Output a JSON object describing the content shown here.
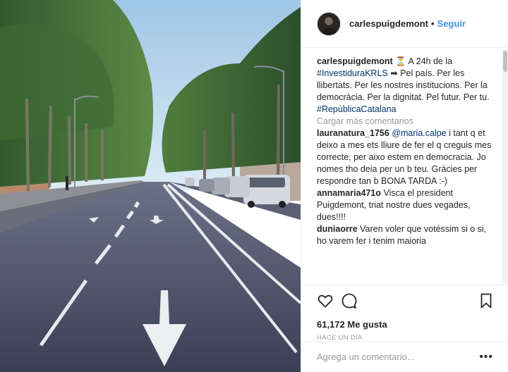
{
  "post": {
    "username": "carlespuigdemont",
    "separator": "•",
    "follow_label": "Seguir"
  },
  "caption": {
    "username": "carlespuigdemont",
    "hourglass": "⏳",
    "text_a": " A 24h de la ",
    "hashtag1": "#InvestiduraKRLS",
    "arrow": " ➡ ",
    "text_b": "Pel país. Per les llibertats. Per les nostres institucions. Per la democràcia. Per la dignitat. Pel futur. Per tu.",
    "hashtag2": "#RepúblicaCatalana"
  },
  "load_more": "Cargar más comentarios",
  "comments": [
    {
      "user": "lauranatura_1756",
      "mention": "@maria.calpe",
      "text": " i tant q et deixo a mes ets lliure de fer el q creguis mes correcte, per aixo estem en democracia. Jo nomes tho deia per un b teu. Gràcies per respondre tan b BONA TARDA :-)"
    },
    {
      "user": "annamaria471o",
      "mention": "",
      "text": " Visca el president Puigdemont, triat nostre dues vegades, dues!!!!"
    },
    {
      "user": "duniaorre",
      "mention": "",
      "text": " Varen voler que votéssim si o si, ho varem fer i tenim maioria"
    }
  ],
  "likes": "61,172 Me gusta",
  "time": "HACE UN DÍA",
  "comment_input": {
    "placeholder": "Agrega un comentario...",
    "value": ""
  },
  "more_label": "•••",
  "icons": {
    "like": "heart-icon",
    "comment": "comment-icon",
    "save": "bookmark-icon",
    "options": "more-options-icon"
  },
  "colors": {
    "accent": "#3897f0",
    "link": "#003569",
    "muted": "#999999",
    "text": "#262626"
  }
}
